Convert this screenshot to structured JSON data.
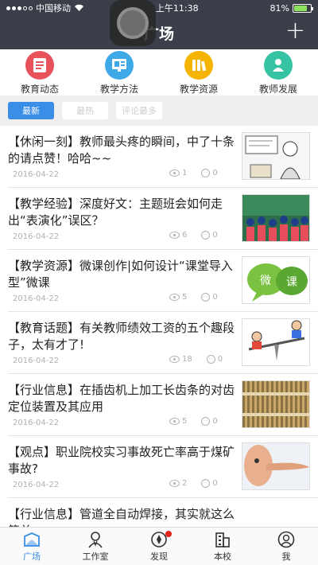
{
  "status_bar": {
    "carrier": "中国移动",
    "time": "上午11:38",
    "battery": "81%",
    "battery_level": 0.81
  },
  "nav": {
    "title": "广场",
    "add_icon": "plus-icon"
  },
  "categories": [
    {
      "label": "教育动态",
      "icon": "news-icon",
      "color": "#e8525a"
    },
    {
      "label": "教学方法",
      "icon": "method-icon",
      "color": "#3fa9e8"
    },
    {
      "label": "教学资源",
      "icon": "resource-icon",
      "color": "#f5b400"
    },
    {
      "label": "教师发展",
      "icon": "teacher-icon",
      "color": "#35c3a3"
    }
  ],
  "filter_tabs": [
    {
      "label": "最新",
      "active": true
    },
    {
      "label": "最热",
      "active": false
    },
    {
      "label": "评论最多",
      "active": false
    }
  ],
  "articles": [
    {
      "title": "【休闲一刻】教师最头疼的瞬间，中了十条的请点赞！哈哈~~",
      "date": "2016-04-22",
      "views": "1",
      "comments": "0",
      "thumb": "comic-teacher"
    },
    {
      "title": "【教学经验】深度好文：主题班会如何走出“表演化”误区？",
      "date": "2016-04-22",
      "views": "6",
      "comments": "0",
      "thumb": "class-photo"
    },
    {
      "title": "【教学资源】微课创作|如何设计“课堂导入型”微课",
      "date": "2016-04-22",
      "views": "5",
      "comments": "0",
      "thumb": "micro-class-bubbles"
    },
    {
      "title": "【教育话题】有关教师绩效工资的五个趣段子，太有才了!",
      "date": "2016-04-22",
      "views": "18",
      "comments": "0",
      "thumb": "seesaw-cartoon"
    },
    {
      "title": "【行业信息】在插齿机上加工长齿条的对齿定位装置及其应用",
      "date": "2016-04-22",
      "views": "5",
      "comments": "0",
      "thumb": "gear-rack"
    },
    {
      "title": "【观点】职业院校实习事故死亡率高于煤矿事故?",
      "date": "2016-04-22",
      "views": "2",
      "comments": "0",
      "thumb": "long-nose"
    },
    {
      "title": "【行业信息】管道全自动焊接，其实就这么简单",
      "date": "",
      "views": "",
      "comments": "",
      "thumb": ""
    }
  ],
  "bottom_tabs": [
    {
      "label": "广场",
      "icon": "square-icon",
      "active": true
    },
    {
      "label": "工作室",
      "icon": "studio-icon",
      "active": false
    },
    {
      "label": "发现",
      "icon": "discover-icon",
      "active": false,
      "badge": true
    },
    {
      "label": "本校",
      "icon": "school-icon",
      "active": false
    },
    {
      "label": "我",
      "icon": "profile-icon",
      "active": false
    }
  ]
}
